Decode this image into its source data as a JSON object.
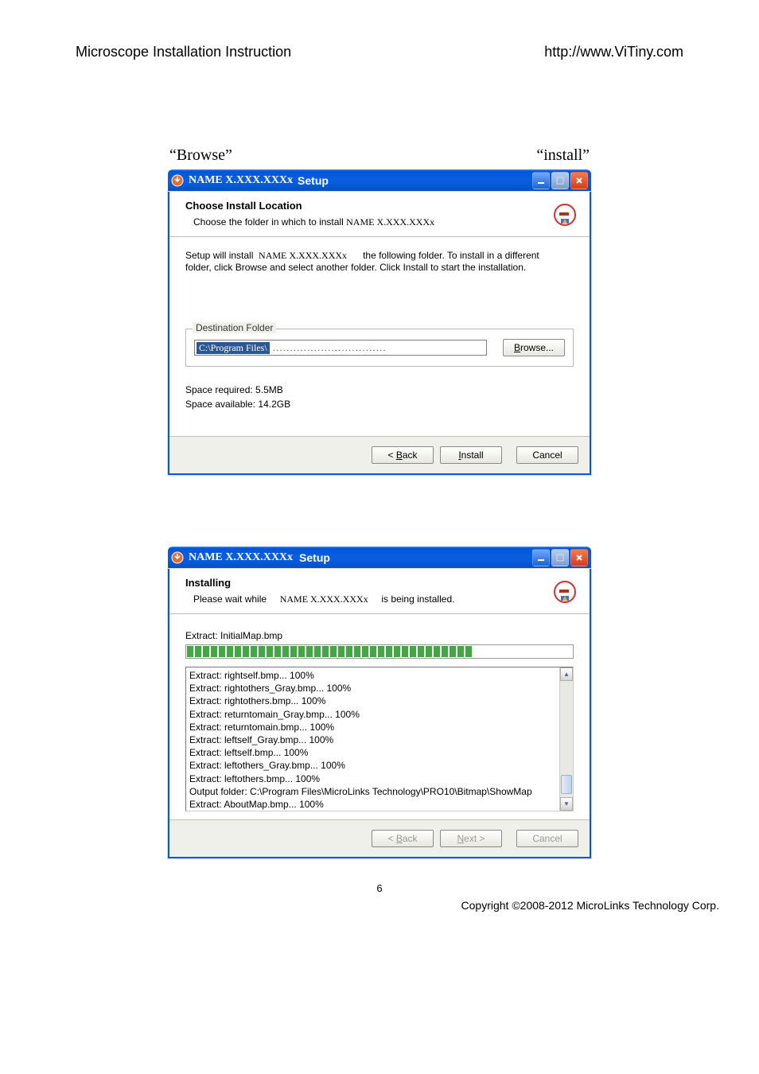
{
  "page": {
    "header_left": "Microscope Installation Instruction",
    "header_right": "http://www.ViTiny.com",
    "page_number": "6",
    "copyright": "Copyright ©2008-2012 MicroLinks Technology Corp."
  },
  "annotation": {
    "browse": "“Browse”",
    "install": "“install”"
  },
  "dialog1": {
    "title_prefix": "NAME X.XXX.XXXx",
    "title_suffix": "Setup",
    "header_bold": "Choose Install Location",
    "header_sub_1": "Choose the folder in which to install ",
    "header_sub_name": "NAME X.XXX.XXXx",
    "body_line1_a": "Setup will install",
    "body_line1_name": "NAME X.XXX.XXXx",
    "body_line1_b": "the following folder. To install in a different",
    "body_line2": "folder, click Browse and select another folder. Click Install to start the installation.",
    "dest_label": "Destination Folder",
    "dest_value": "C:\\Program Files\\",
    "browse_btn": "Browse...",
    "space_required": "Space required: 5.5MB",
    "space_available": "Space available: 14.2GB",
    "btn_back": "< Back",
    "btn_install": "Install",
    "btn_cancel": "Cancel"
  },
  "dialog2": {
    "title_prefix": "NAME X.XXX.XXXx",
    "title_suffix": "Setup",
    "header_bold": "Installing",
    "header_sub_1": "Please wait while",
    "header_sub_name": "NAME X.XXX.XXXx",
    "header_sub_2": "is being installed.",
    "progress_label": "Extract: InitialMap.bmp",
    "progress_segments": 36,
    "log_lines": [
      "Extract: rightself.bmp... 100%",
      "Extract: rightothers_Gray.bmp... 100%",
      "Extract: rightothers.bmp... 100%",
      "Extract: returntomain_Gray.bmp... 100%",
      "Extract: returntomain.bmp... 100%",
      "Extract: leftself_Gray.bmp... 100%",
      "Extract: leftself.bmp... 100%",
      "Extract: leftothers_Gray.bmp... 100%",
      "Extract: leftothers.bmp... 100%",
      "Output folder: C:\\Program Files\\MicroLinks Technology\\PRO10\\Bitmap\\ShowMap",
      "Extract: AboutMap.bmp... 100%",
      "Extract: InitialMap.bmp"
    ],
    "btn_back": "< Back",
    "btn_next": "Next >",
    "btn_cancel": "Cancel"
  }
}
